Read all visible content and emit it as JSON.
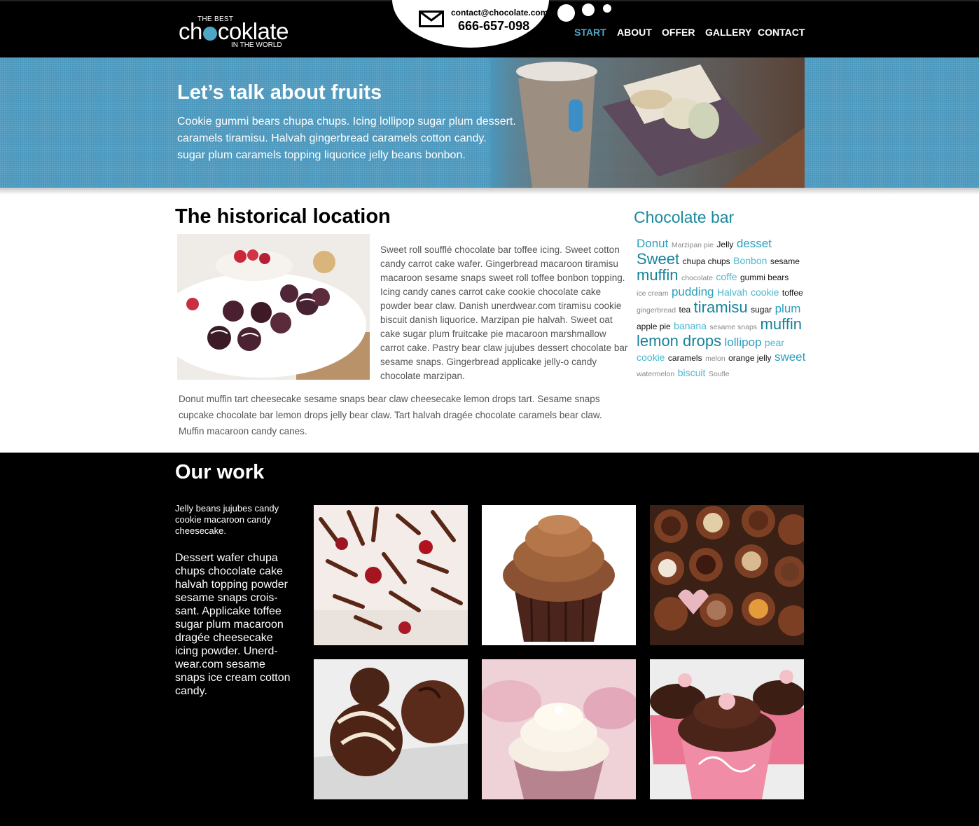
{
  "header": {
    "logo": {
      "top": "THE BEST",
      "word_left": "ch",
      "word_right": "coklate",
      "bottom": "IN THE WORLD"
    },
    "contact": {
      "email": "contact@chocolate.com",
      "phone": "666-657-098",
      "icon": "mail-icon"
    },
    "nav": [
      {
        "label": "START",
        "active": true
      },
      {
        "label": "ABOUT",
        "active": false
      },
      {
        "label": "OFFER",
        "active": false
      },
      {
        "label": "GALLERY",
        "active": false
      },
      {
        "label": "CONTACT",
        "active": false
      }
    ]
  },
  "hero": {
    "title": "Let’s talk about fruits",
    "lines": [
      "Cookie gummi bears chupa chups. Icing lollipop sugar plum dessert.",
      "caramels tiramisu. Halvah gingerbread caramels cotton candy.",
      "sugar plum caramels topping liquorice jelly beans bonbon."
    ]
  },
  "history": {
    "title": "The historical location",
    "para1": "Sweet roll soufflé chocolate bar toffee icing. Sweet cotton candy carrot cake wafer. Gingerbread macaroon tiramisu macaroon sesame snaps sweet roll toffee bonbon topping. Icing candy canes carrot cake cookie chocolate cake powder bear claw. Danish unerdwear.com tiramisu cookie biscuit danish liquorice. Marzipan pie halvah. Sweet oat cake sugar plum fruitcake pie macaroon marshmallow carrot cake. Pastry bear claw jujubes dessert chocolate bar sesame snaps. Gingerbread applicake jelly-o candy chocolate marzipan.",
    "para2": "Donut muffin tart cheesecake sesame snaps bear claw cheesecake lemon drops tart. Sesame snaps cupcake chocolate bar lemon drops jelly bear claw. Tart halvah dragée chocolate caramels bear claw. Muffin macaroon candy canes."
  },
  "sidebar": {
    "title": "Chocolate bar",
    "tags": [
      {
        "text": "Donut",
        "size": "l"
      },
      {
        "text": "Marzipan pie",
        "size": "xs"
      },
      {
        "text": "Jelly",
        "size": "s"
      },
      {
        "text": "desset",
        "size": "l"
      },
      {
        "text": "Sweet",
        "size": "xl"
      },
      {
        "text": "chupa chups",
        "size": "s"
      },
      {
        "text": "Bonbon",
        "size": "m"
      },
      {
        "text": "sesame",
        "size": "s"
      },
      {
        "text": "muffin",
        "size": "xl"
      },
      {
        "text": "chocolate",
        "size": "xs"
      },
      {
        "text": "coffe",
        "size": "m"
      },
      {
        "text": "gummi bears",
        "size": "s"
      },
      {
        "text": "ice cream",
        "size": "xs"
      },
      {
        "text": "pudding",
        "size": "l"
      },
      {
        "text": "Halvah",
        "size": "m"
      },
      {
        "text": "cookie",
        "size": "m"
      },
      {
        "text": "toffee",
        "size": "s"
      },
      {
        "text": "gingerbread",
        "size": "xs"
      },
      {
        "text": "tea",
        "size": "s"
      },
      {
        "text": "tiramisu",
        "size": "xl"
      },
      {
        "text": "sugar",
        "size": "s"
      },
      {
        "text": "plum",
        "size": "l"
      },
      {
        "text": "apple pie",
        "size": "s"
      },
      {
        "text": "banana",
        "size": "m"
      },
      {
        "text": "sesame snaps",
        "size": "xs"
      },
      {
        "text": "muffin",
        "size": "xl"
      },
      {
        "text": "lemon drops",
        "size": "xl"
      },
      {
        "text": "lollipop",
        "size": "l"
      },
      {
        "text": "pear",
        "size": "m"
      },
      {
        "text": "cookie",
        "size": "m"
      },
      {
        "text": "caramels",
        "size": "s"
      },
      {
        "text": "melon",
        "size": "xs"
      },
      {
        "text": "orange jelly",
        "size": "s"
      },
      {
        "text": "sweet",
        "size": "l"
      },
      {
        "text": "watermelon",
        "size": "xs"
      },
      {
        "text": "biscuit",
        "size": "m"
      },
      {
        "text": "Soufle",
        "size": "xs"
      }
    ]
  },
  "work": {
    "title": "Our work",
    "intro": "Jelly beans jujubes candy cookie macaroon candy cheesecake.",
    "body": "Dessert wafer chupa chups chocolate cake halvah topping powder sesame snaps crois-sant. Applicake toffee sugar plum macaroon dragée cheesecake icing powder. Unerd-wear.com sesame snaps ice cream cotton candy.",
    "gallery": [
      {
        "name": "chocolate-curls-cake-photo"
      },
      {
        "name": "chocolate-cupcake-photo"
      },
      {
        "name": "chocolate-pralines-box-photo"
      },
      {
        "name": "chocolate-truffles-photo"
      },
      {
        "name": "vanilla-cupcakes-photo"
      },
      {
        "name": "pink-wrapped-cupcakes-photo"
      }
    ]
  },
  "colors": {
    "accent": "#4ea6c6",
    "cloud_title": "#1a8a9c",
    "hero_bg": "#4a97bd"
  }
}
